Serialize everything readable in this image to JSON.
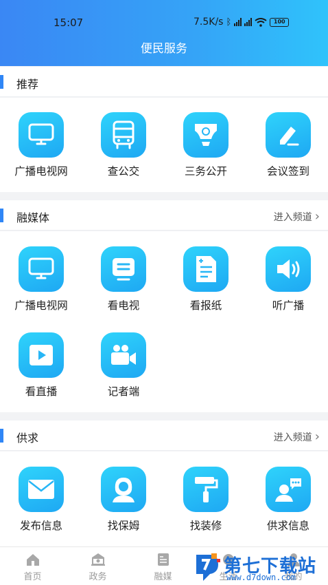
{
  "status_bar": {
    "time": "15:07",
    "speed": "7.5K/s",
    "battery": "100"
  },
  "header": {
    "title": "便民服务"
  },
  "sections": [
    {
      "title": "推荐",
      "more": "",
      "items": [
        {
          "label": "广播电视网",
          "icon": "tv-icon"
        },
        {
          "label": "查公交",
          "icon": "bus-icon"
        },
        {
          "label": "三务公开",
          "icon": "badge-icon"
        },
        {
          "label": "会议签到",
          "icon": "edit-icon"
        }
      ]
    },
    {
      "title": "融媒体",
      "more": "进入频道",
      "items": [
        {
          "label": "广播电视网",
          "icon": "tv-icon"
        },
        {
          "label": "看电视",
          "icon": "television-icon"
        },
        {
          "label": "看报纸",
          "icon": "newspaper-icon"
        },
        {
          "label": "听广播",
          "icon": "speaker-icon"
        },
        {
          "label": "看直播",
          "icon": "play-icon"
        },
        {
          "label": "记者端",
          "icon": "video-camera-icon"
        }
      ]
    },
    {
      "title": "供求",
      "more": "进入频道",
      "items": [
        {
          "label": "发布信息",
          "icon": "mail-icon"
        },
        {
          "label": "找保姆",
          "icon": "nanny-icon"
        },
        {
          "label": "找装修",
          "icon": "paint-roller-icon"
        },
        {
          "label": "供求信息",
          "icon": "chat-user-icon"
        }
      ]
    }
  ],
  "tabs": [
    {
      "label": "首页",
      "icon": "home-icon"
    },
    {
      "label": "政务",
      "icon": "government-icon"
    },
    {
      "label": "融媒",
      "icon": "media-icon"
    },
    {
      "label": "生活",
      "icon": "life-icon"
    },
    {
      "label": "我的",
      "icon": "user-icon"
    }
  ],
  "watermark": {
    "name": "第七下载站",
    "url": "www.d7down.com"
  },
  "colors": {
    "accent": "#2f86f6",
    "icon_gradient_start": "#2fd3fb",
    "icon_gradient_end": "#1ea8f3"
  }
}
